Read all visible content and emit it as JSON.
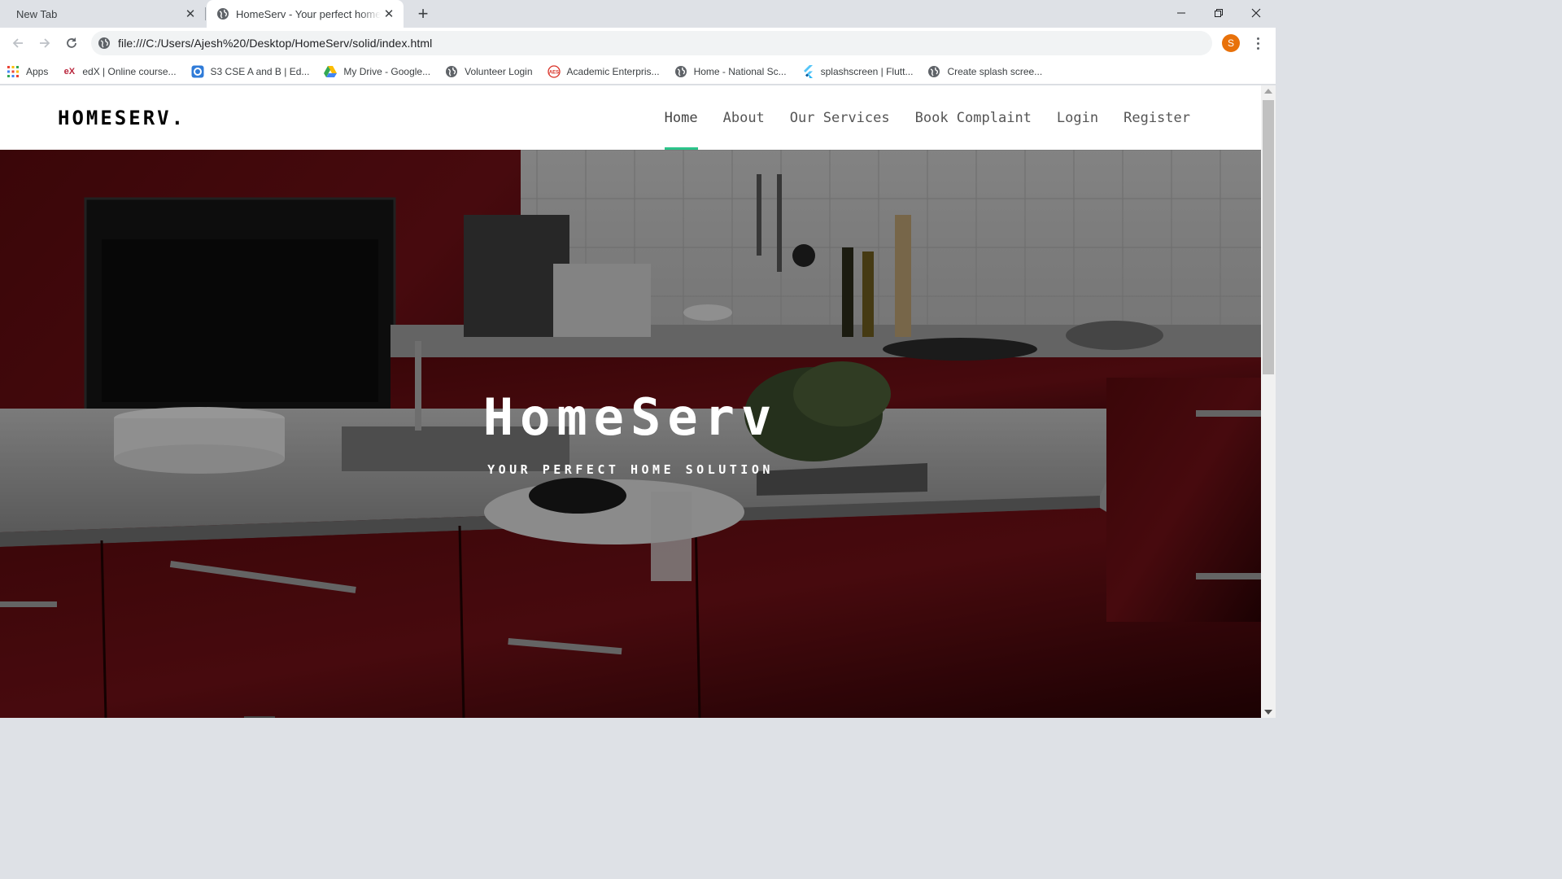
{
  "browser": {
    "tabs": [
      {
        "title": "New Tab",
        "active": false
      },
      {
        "title": "HomeServ - Your perfect home solution",
        "active": true
      }
    ],
    "url": "file:///C:/Users/Ajesh%20/Desktop/HomeServ/solid/index.html",
    "profile_initial": "S",
    "bookmarks": [
      {
        "label": "Apps",
        "icon": "apps-grid-icon"
      },
      {
        "label": "edX | Online course...",
        "icon": "edx-icon"
      },
      {
        "label": "S3 CSE A and B | Ed...",
        "icon": "edmodo-icon"
      },
      {
        "label": "My Drive - Google...",
        "icon": "google-drive-icon"
      },
      {
        "label": "Volunteer Login",
        "icon": "globe-icon"
      },
      {
        "label": "Academic Enterpris...",
        "icon": "aes-icon"
      },
      {
        "label": "Home - National Sc...",
        "icon": "globe-icon"
      },
      {
        "label": "splashscreen | Flutt...",
        "icon": "flutter-icon"
      },
      {
        "label": "Create splash scree...",
        "icon": "globe-icon"
      }
    ]
  },
  "site": {
    "brand": "HOMESERV.",
    "nav": [
      {
        "label": "Home",
        "active": true
      },
      {
        "label": "About",
        "active": false
      },
      {
        "label": "Our Services",
        "active": false
      },
      {
        "label": "Book Complaint",
        "active": false
      },
      {
        "label": "Login",
        "active": false
      },
      {
        "label": "Register",
        "active": false
      }
    ],
    "hero": {
      "title": "HomeServ",
      "subtitle": "YOUR PERFECT HOME SOLUTION"
    },
    "accent_color": "#2bc48a"
  }
}
